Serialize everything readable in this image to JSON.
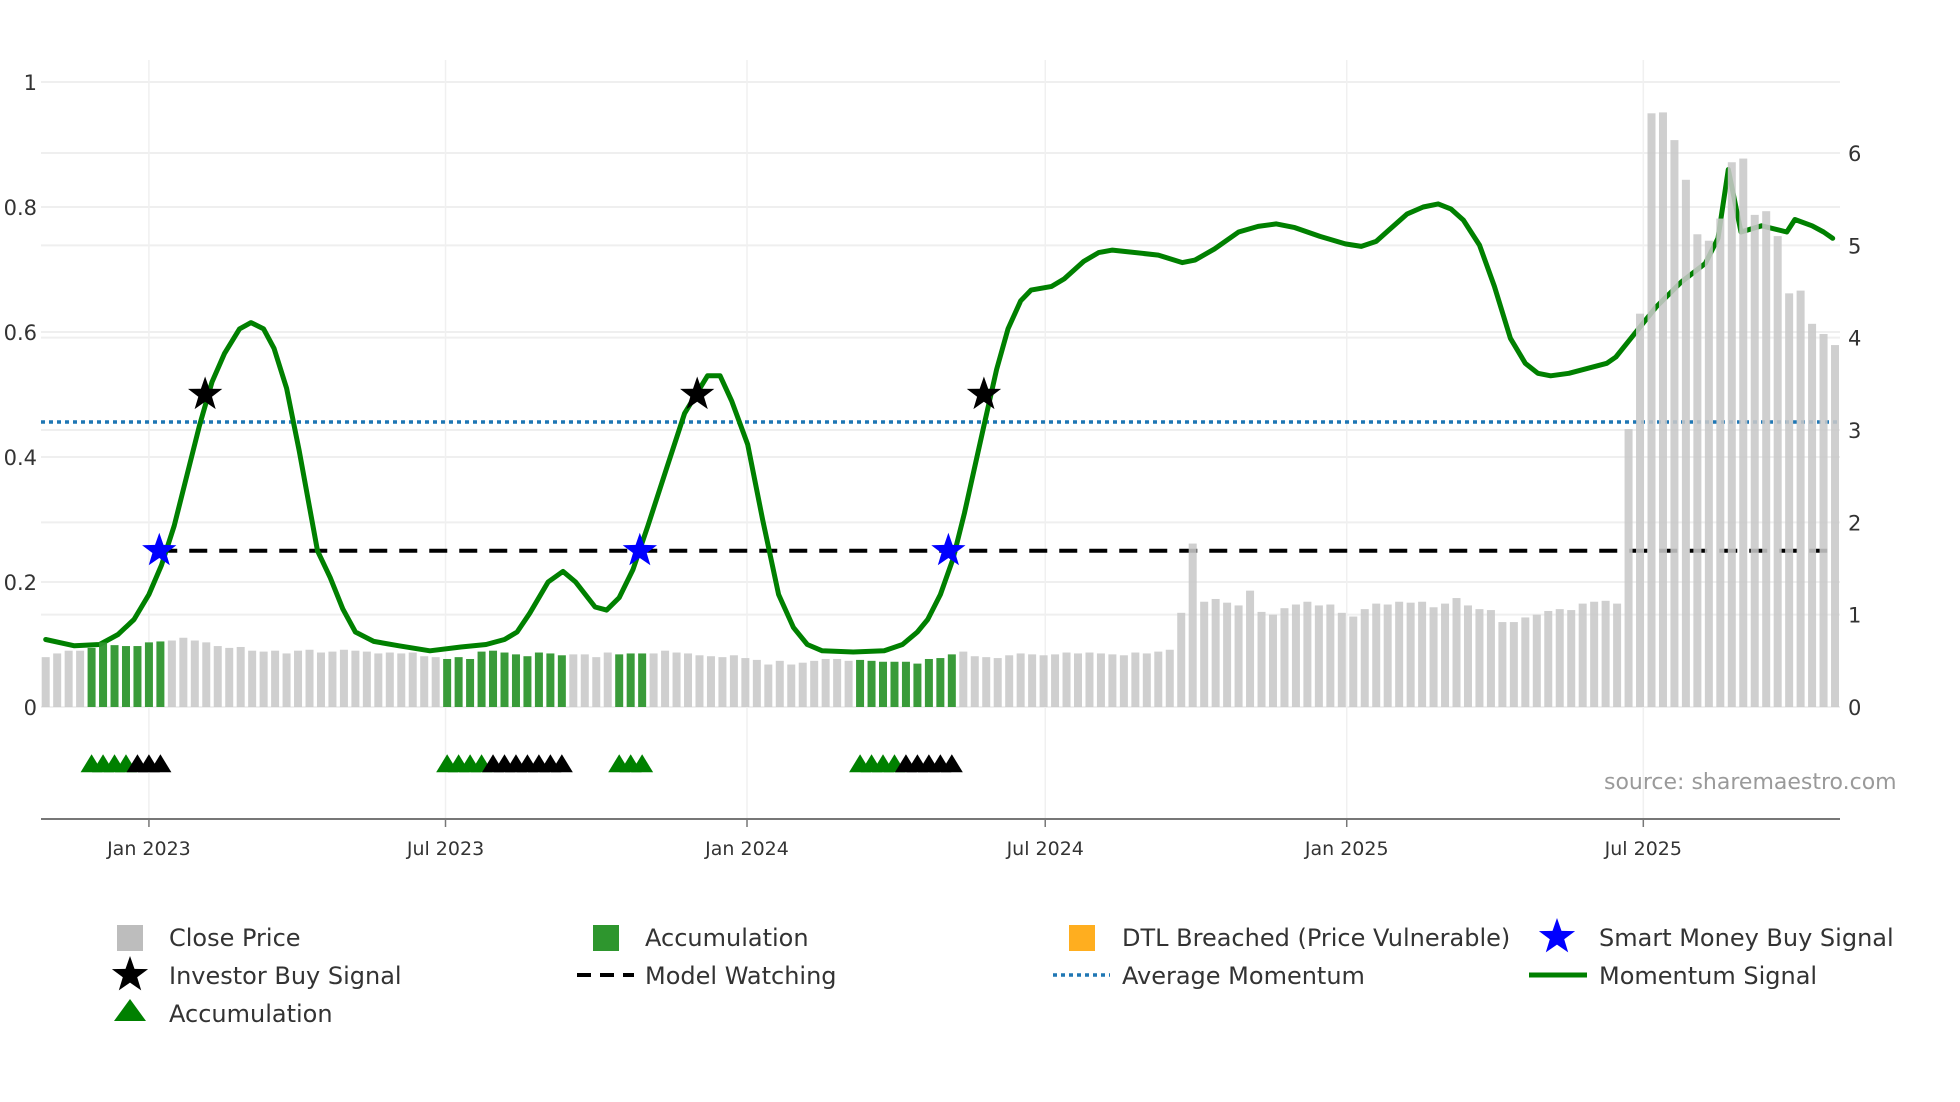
{
  "chart_data": {
    "type": "bar+line",
    "start_date": "2022-10-30",
    "interval": "weekly",
    "left_axis": {
      "ylim": [
        -0.183,
        1.04
      ],
      "ticks": [
        "0",
        "0.2",
        "0.4",
        "0.6",
        "0.8",
        "1"
      ],
      "tick_values": [
        0,
        0.2,
        0.4,
        0.6,
        0.8,
        1
      ]
    },
    "right_axis": {
      "ylim": [
        0,
        6.5
      ],
      "ticks": [
        "0",
        "1",
        "2",
        "3",
        "4",
        "5",
        "6"
      ],
      "tick_values": [
        0,
        1,
        2,
        3,
        4,
        5,
        6
      ]
    },
    "x_ticks": [
      {
        "date": "2023-01-01",
        "label": "Jan 2023"
      },
      {
        "date": "2023-07-01",
        "label": "Jul 2023"
      },
      {
        "date": "2024-01-01",
        "label": "Jan 2024"
      },
      {
        "date": "2024-07-01",
        "label": "Jul 2024"
      },
      {
        "date": "2025-01-01",
        "label": "Jan 2025"
      },
      {
        "date": "2025-07-01",
        "label": "Jul 2025"
      }
    ],
    "close_price": [
      0.54,
      0.58,
      0.61,
      0.61,
      0.64,
      0.7,
      0.67,
      0.66,
      0.66,
      0.7,
      0.71,
      0.72,
      0.75,
      0.72,
      0.7,
      0.66,
      0.64,
      0.65,
      0.61,
      0.6,
      0.61,
      0.58,
      0.61,
      0.62,
      0.59,
      0.6,
      0.62,
      0.61,
      0.6,
      0.58,
      0.59,
      0.58,
      0.59,
      0.55,
      0.54,
      0.52,
      0.54,
      0.52,
      0.6,
      0.61,
      0.59,
      0.57,
      0.55,
      0.59,
      0.58,
      0.56,
      0.57,
      0.57,
      0.54,
      0.59,
      0.57,
      0.58,
      0.58,
      0.58,
      0.61,
      0.59,
      0.58,
      0.56,
      0.55,
      0.54,
      0.56,
      0.53,
      0.51,
      0.46,
      0.5,
      0.46,
      0.48,
      0.5,
      0.52,
      0.52,
      0.5,
      0.51,
      0.5,
      0.49,
      0.49,
      0.49,
      0.47,
      0.52,
      0.53,
      0.57,
      0.6,
      0.55,
      0.54,
      0.53,
      0.56,
      0.58,
      0.57,
      0.56,
      0.57,
      0.59,
      0.58,
      0.59,
      0.58,
      0.57,
      0.56,
      0.59,
      0.58,
      0.6,
      0.62,
      1.02,
      1.77,
      1.14,
      1.17,
      1.13,
      1.1,
      1.26,
      1.03,
      1.0,
      1.07,
      1.11,
      1.14,
      1.1,
      1.11,
      1.02,
      0.98,
      1.06,
      1.12,
      1.11,
      1.14,
      1.13,
      1.14,
      1.08,
      1.12,
      1.18,
      1.1,
      1.06,
      1.05,
      0.92,
      0.92,
      0.97,
      1.0,
      1.04,
      1.06,
      1.05,
      1.12,
      1.14,
      1.15,
      1.12,
      3.01,
      4.26,
      6.43,
      6.44,
      6.14,
      5.71,
      5.12,
      5.05,
      5.29,
      5.9,
      5.94,
      5.33,
      5.37,
      5.1,
      4.48,
      4.51,
      4.15,
      4.04,
      3.92
    ],
    "accumulation_weeks": [
      4,
      5,
      6,
      7,
      8,
      9,
      10,
      35,
      36,
      37,
      38,
      39,
      40,
      41,
      42,
      43,
      44,
      45,
      50,
      51,
      52,
      71,
      72,
      73,
      74,
      75,
      76,
      77,
      78,
      79
    ],
    "momentum": {
      "week": [
        0,
        2.5,
        4.7,
        6.3,
        7.7,
        9.0,
        10.1,
        11.2,
        12.3,
        13.4,
        14.5,
        15.6,
        16.9,
        17.9,
        19.0,
        19.9,
        21.0,
        22.1,
        23.7,
        24.8,
        25.9,
        27.0,
        28.6,
        30.8,
        33.5,
        36.2,
        38.4,
        40.0,
        41.1,
        42.2,
        43.8,
        45.1,
        46.2,
        47.9,
        48.9,
        50.0,
        51.2,
        52.5,
        54.1,
        55.7,
        57.7,
        58.8,
        59.8,
        61.2,
        62.5,
        63.9,
        65.2,
        66.4,
        67.7,
        70.4,
        73.1,
        74.7,
        76.0,
        76.9,
        78.0,
        79.1,
        80.1,
        81.8,
        82.9,
        83.9,
        85.0,
        85.9,
        87.7,
        88.8,
        90.5,
        91.8,
        93.0,
        97.0,
        99.1,
        100.2,
        101.9,
        104.0,
        105.7,
        107.3,
        108.9,
        111.1,
        113.3,
        114.7,
        116.0,
        117.1,
        118.7,
        120.1,
        121.4,
        122.5,
        123.6,
        125.0,
        126.3,
        127.7,
        129.0,
        130.1,
        131.2,
        132.8,
        136.1,
        136.9,
        138.2,
        140.4,
        142.6,
        144.7,
        145.8,
        146.7,
        147.8,
        149.6,
        151.8,
        152.5,
        154.0,
        155.0,
        155.8
      ],
      "value": [
        0.108,
        0.098,
        0.1,
        0.116,
        0.14,
        0.18,
        0.227,
        0.29,
        0.37,
        0.45,
        0.52,
        0.566,
        0.605,
        0.615,
        0.605,
        0.574,
        0.51,
        0.41,
        0.25,
        0.207,
        0.157,
        0.12,
        0.105,
        0.098,
        0.09,
        0.096,
        0.1,
        0.108,
        0.12,
        0.15,
        0.2,
        0.217,
        0.2,
        0.16,
        0.155,
        0.175,
        0.22,
        0.29,
        0.38,
        0.47,
        0.53,
        0.53,
        0.49,
        0.42,
        0.3,
        0.18,
        0.127,
        0.1,
        0.09,
        0.088,
        0.09,
        0.1,
        0.12,
        0.14,
        0.18,
        0.237,
        0.31,
        0.45,
        0.54,
        0.605,
        0.65,
        0.667,
        0.673,
        0.685,
        0.713,
        0.727,
        0.731,
        0.723,
        0.711,
        0.715,
        0.733,
        0.76,
        0.769,
        0.773,
        0.767,
        0.753,
        0.741,
        0.737,
        0.745,
        0.763,
        0.789,
        0.8,
        0.805,
        0.797,
        0.779,
        0.739,
        0.673,
        0.59,
        0.55,
        0.534,
        0.53,
        0.534,
        0.55,
        0.56,
        0.59,
        0.64,
        0.68,
        0.71,
        0.75,
        0.86,
        0.76,
        0.77,
        0.76,
        0.78,
        0.77,
        0.76,
        0.75
      ]
    },
    "average_momentum": 0.456,
    "model_watching": {
      "value": 0.25,
      "from_week": 9.9
    },
    "smart_money_buy_signals": [
      {
        "week": 9.9,
        "value": 0.25
      },
      {
        "week": 51.8,
        "value": 0.25
      },
      {
        "week": 78.7,
        "value": 0.25
      }
    ],
    "investor_buy_signals": [
      {
        "week": 13.9,
        "value": 0.5
      },
      {
        "week": 56.8,
        "value": 0.5
      },
      {
        "week": 81.8,
        "value": 0.5
      }
    ],
    "accumulation_markers": {
      "level": -0.09,
      "green_weeks": [
        4,
        5,
        6,
        7,
        35,
        36,
        37,
        38,
        50,
        51,
        52,
        71,
        72,
        73,
        74
      ],
      "black_weeks": [
        8,
        9,
        10,
        39,
        40,
        41,
        42,
        43,
        44,
        45,
        75,
        76,
        77,
        78,
        79
      ]
    },
    "legend": {
      "position": "bottom",
      "entries": [
        "Close Price",
        "Accumulation",
        "DTL Breached (Price Vulnerable)",
        "Smart Money Buy Signal",
        "Investor Buy Signal",
        "Model Watching",
        "Average Momentum",
        "Momentum Signal",
        "Accumulation"
      ]
    },
    "annotation": "source: sharemaestro.com",
    "colors": {
      "price": "#c8c8c8",
      "accumulation": "#2e962e",
      "dtl": "#ffae1f",
      "smart": "#0000ff",
      "investor": "#000000",
      "avg": "#1f77b4",
      "momentum": "#008000"
    }
  }
}
